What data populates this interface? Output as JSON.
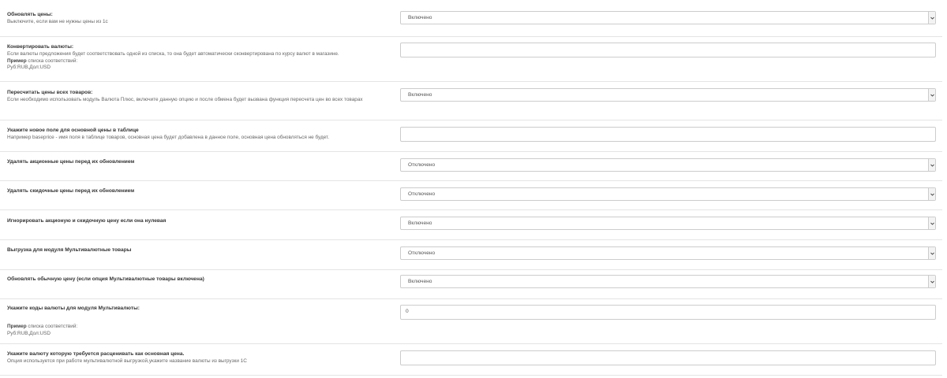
{
  "settings": [
    {
      "title": "Обновлять цены:",
      "help": "Выключите, если вам не нужны цены из 1с",
      "control": "select",
      "value": "Включено"
    },
    {
      "title": "Конвертировать валюты:",
      "help": "Если валюты предложения будет соответствовать одной из списка, то она будет автоматически сконвертирована по курсу валют в магазине.",
      "example_label": "Пример",
      "example_suffix": " списка соответствий:",
      "example_value": "Руб:RUB,Дол:USD",
      "control": "input",
      "value": ""
    },
    {
      "title": "Пересчитать цены всех товаров:",
      "help": "Если необходимо использовать модуль Валюта Плюс, включите данную опцию и после обмена будет вызвана функция пересчета цен во всех товарах",
      "control": "select",
      "value": "Включено"
    },
    {
      "title": "Укажите новое поле для основной цены в таблице",
      "help": "Например baseprice - имя поля в таблице товаров, основная цена будет добавлена в данное поле, основная цена обновляться не будет.",
      "control": "input",
      "value": ""
    },
    {
      "title": "Удалять акционные цены перед их обновлением",
      "control": "select",
      "value": "Отключено"
    },
    {
      "title": "Удалять скидочные цены перед их обновлением",
      "control": "select",
      "value": "Отключено"
    },
    {
      "title": "Игнорировать акционую и скидочную цену если она нулевая",
      "control": "select",
      "value": "Включено"
    },
    {
      "title": "Выгрузка для модуля Мультивалютные товары",
      "control": "select",
      "value": "Отключено"
    },
    {
      "title": "Обновлять обычную цену (если опция Мультивалютные товары включена)",
      "control": "select",
      "value": "Включено"
    },
    {
      "title": "Укажите коды валюты для модуля Мультивалюты:",
      "example_label": "Пример",
      "example_suffix": " списка соответствий:",
      "example_value": "Руб:RUB,Дол:USD",
      "control": "input",
      "value": "0"
    },
    {
      "title": "Укажите валюту которую требуется расценивать как основная цена.",
      "help": "Опция используется при работе мультивалютной выгрузкой,укажите название валюты из выгрузки 1С",
      "control": "input",
      "value": ""
    }
  ],
  "colors": {
    "border": "#cccccc",
    "divider": "#e4e4e4",
    "text": "#333333",
    "muted": "#666666"
  },
  "icons": {
    "select_arrow": "chevron-down-icon"
  }
}
